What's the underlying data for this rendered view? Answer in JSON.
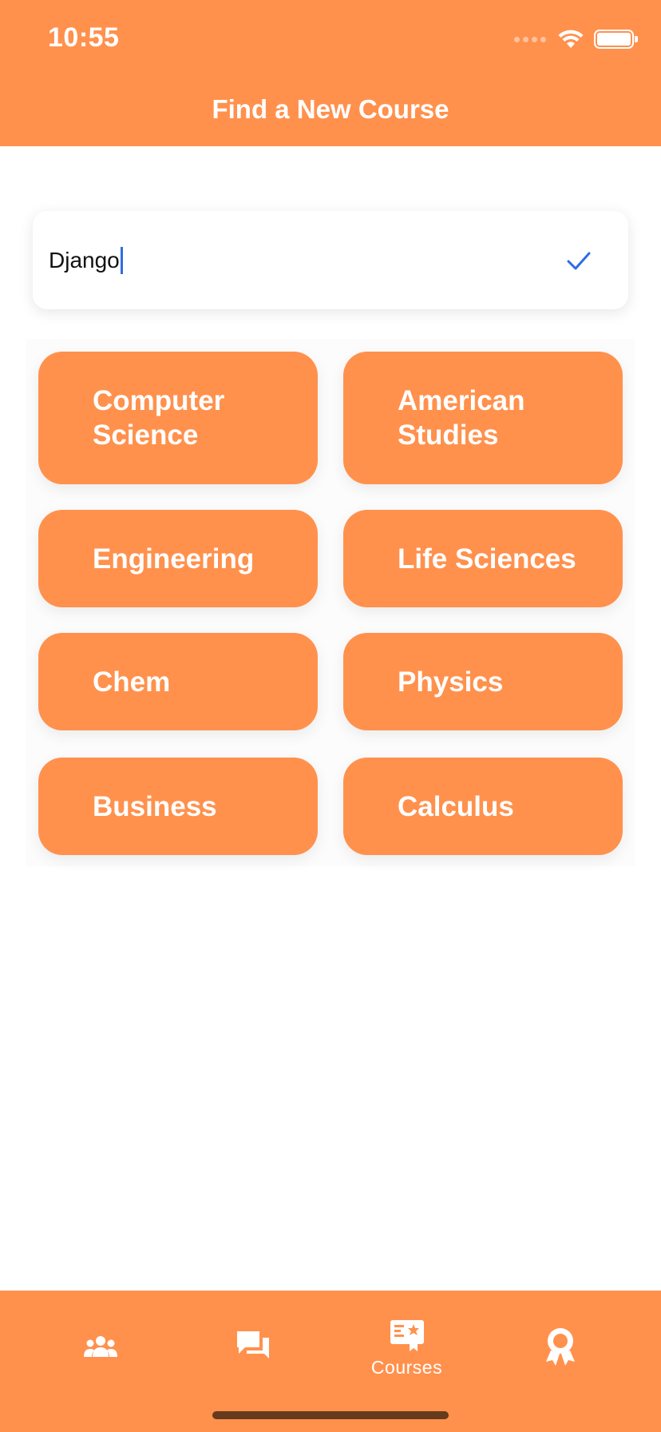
{
  "status_bar": {
    "time": "10:55"
  },
  "header": {
    "title": "Find a New Course"
  },
  "search": {
    "value": "Django"
  },
  "courses": [
    {
      "label": "Computer\nScience"
    },
    {
      "label": "American\nStudies"
    },
    {
      "label": "Engineering"
    },
    {
      "label": "Life Sciences"
    },
    {
      "label": "Chem"
    },
    {
      "label": "Physics"
    },
    {
      "label": "Business"
    },
    {
      "label": "Calculus"
    }
  ],
  "tabbar": {
    "tabs": [
      {
        "icon": "people-icon",
        "label": ""
      },
      {
        "icon": "chat-icon",
        "label": ""
      },
      {
        "icon": "courses-icon",
        "label": "Courses"
      },
      {
        "icon": "award-icon",
        "label": ""
      }
    ]
  },
  "colors": {
    "accent": "#FF914D",
    "cursor": "#2F6BE6",
    "check": "#2F6BE6"
  }
}
